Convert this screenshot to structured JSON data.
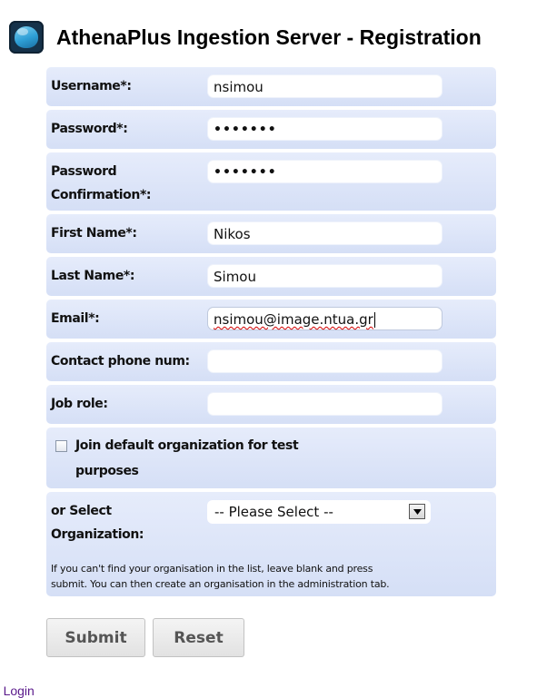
{
  "header": {
    "title": "AthenaPlus Ingestion Server - Registration",
    "logo_icon": "athenaplus-logo-icon"
  },
  "form": {
    "username": {
      "label": "Username*:",
      "value": "nsimou"
    },
    "password": {
      "label": "Password*:",
      "value": "•••••••"
    },
    "password_confirmation": {
      "label_line1": "Password",
      "label_line2": "Confirmation*:",
      "value": "•••••••"
    },
    "first_name": {
      "label": "First Name*:",
      "value": "Nikos"
    },
    "last_name": {
      "label": "Last Name*:",
      "value": "Simou"
    },
    "email": {
      "label": "Email*:",
      "value": "nsimou@image.ntua.gr"
    },
    "contact_phone": {
      "label": "Contact phone num:",
      "value": ""
    },
    "job_role": {
      "label": "Job role:",
      "value": ""
    },
    "default_org": {
      "label_line1": "Join default organization for test",
      "label_line2": "purposes",
      "checked": false
    },
    "organization": {
      "label_line1": "or Select",
      "label_line2": "Organization:",
      "selected": "-- Please Select --",
      "note_line1": "If you can't find your organisation in the list, leave blank and press",
      "note_line2": "submit. You can then create an organisation in the administration tab."
    }
  },
  "buttons": {
    "submit": "Submit",
    "reset": "Reset"
  },
  "back_link": "to Login",
  "colors": {
    "row_background": "#dce4f8",
    "link": "#5a1a8b"
  }
}
